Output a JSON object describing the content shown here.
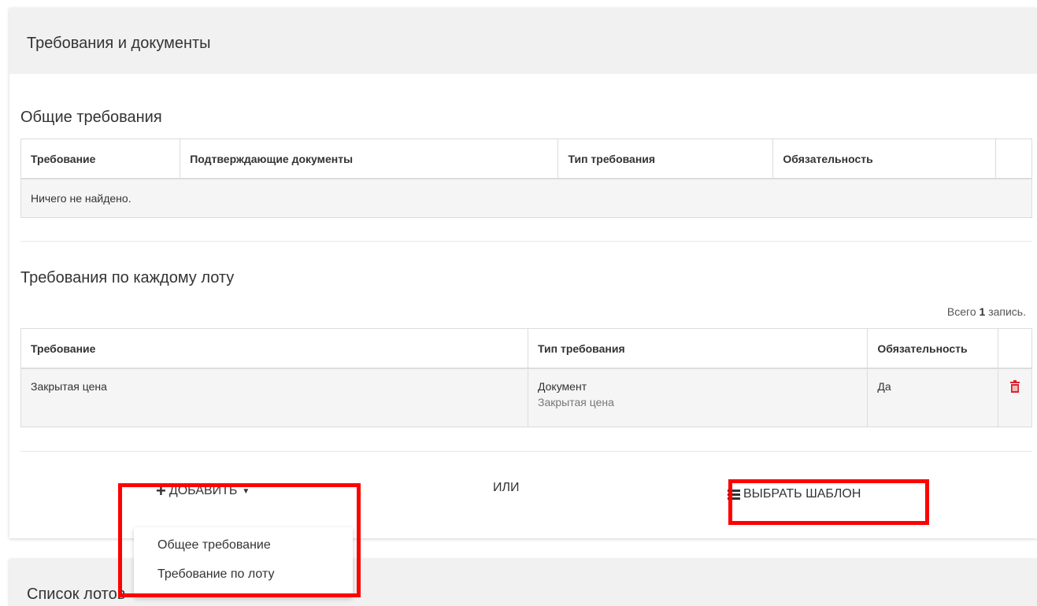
{
  "section": {
    "title": "Требования и документы"
  },
  "general": {
    "title": "Общие требования",
    "columns": [
      "Требование",
      "Подтверждающие документы",
      "Тип требования",
      "Обязательность"
    ],
    "empty_text": "Ничего не найдено."
  },
  "per_lot": {
    "title": "Требования по каждому лоту",
    "total_prefix": "Всего",
    "total_count": "1",
    "total_suffix": "запись.",
    "columns": [
      "Требование",
      "Тип требования",
      "Обязательность"
    ],
    "rows": [
      {
        "requirement": "Закрытая цена",
        "type": "Документ",
        "type_sub": "Закрытая цена",
        "mandatory": "Да"
      }
    ]
  },
  "actions": {
    "add_label": "ДОБАВИТЬ",
    "or_label": "ИЛИ",
    "template_label": "ВЫБРАТЬ ШАБЛОН",
    "dropdown": [
      "Общее требование",
      "Требование по лоту"
    ]
  },
  "next_section": {
    "title": "Список лотов"
  },
  "colors": {
    "highlight": "#ff0000",
    "delete": "#d9232d",
    "header_bg": "#f1f1f1"
  },
  "icons": {
    "add": "plus-icon",
    "caret": "caret-down-icon",
    "template": "list-icon",
    "delete": "trash-icon"
  }
}
